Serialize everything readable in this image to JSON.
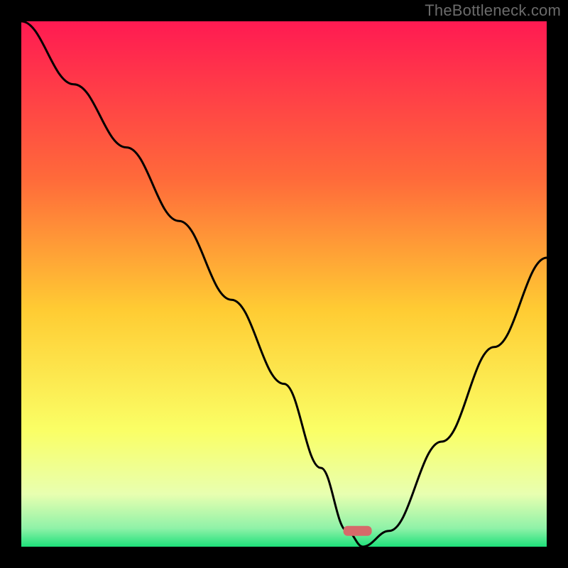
{
  "watermark": {
    "text": "TheBottleneck.com"
  },
  "chart_data": {
    "type": "line",
    "title": "",
    "xlabel": "",
    "ylabel": "",
    "xlim": [
      0,
      100
    ],
    "ylim": [
      0,
      100
    ],
    "x": [
      0,
      10,
      20,
      30,
      40,
      50,
      57,
      62,
      65,
      70,
      80,
      90,
      100
    ],
    "values": [
      100,
      88,
      76,
      62,
      47,
      31,
      15,
      3,
      0,
      3,
      20,
      38,
      55
    ],
    "minimum_x": 64,
    "flat_bottom_range": [
      60,
      67
    ],
    "marker": {
      "x": 64,
      "y": 3,
      "color": "#d66a6a"
    },
    "gradient_stops": [
      {
        "offset": 0.0,
        "color": "#ff1a52"
      },
      {
        "offset": 0.3,
        "color": "#ff6a3a"
      },
      {
        "offset": 0.55,
        "color": "#ffcc33"
      },
      {
        "offset": 0.78,
        "color": "#faff66"
      },
      {
        "offset": 0.9,
        "color": "#e8ffb0"
      },
      {
        "offset": 0.965,
        "color": "#8ff2a8"
      },
      {
        "offset": 1.0,
        "color": "#1ee07a"
      }
    ],
    "curve_color": "#000000",
    "curve_width": 3
  }
}
